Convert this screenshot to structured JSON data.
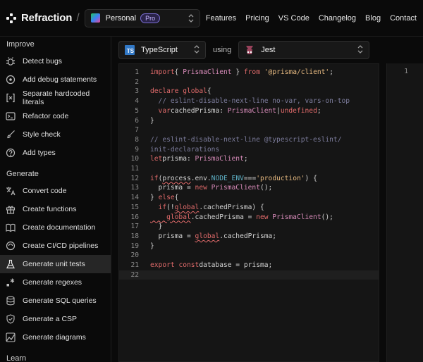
{
  "brand": {
    "name": "Refraction"
  },
  "team": {
    "name": "Personal",
    "badge": "Pro"
  },
  "nav": {
    "items": [
      "Features",
      "Pricing",
      "VS Code",
      "Changelog",
      "Blog",
      "Contact"
    ]
  },
  "sidebar": {
    "sections": [
      {
        "title": "Improve",
        "items": [
          {
            "label": "Detect bugs",
            "icon": "bug-icon"
          },
          {
            "label": "Add debug statements",
            "icon": "debug-icon"
          },
          {
            "label": "Separate hardcoded literals",
            "icon": "brackets-x-icon"
          },
          {
            "label": "Refactor code",
            "icon": "terminal-icon"
          },
          {
            "label": "Style check",
            "icon": "brush-icon"
          },
          {
            "label": "Add types",
            "icon": "question-circle-icon"
          }
        ]
      },
      {
        "title": "Generate",
        "items": [
          {
            "label": "Convert code",
            "icon": "translate-icon"
          },
          {
            "label": "Create functions",
            "icon": "gift-icon"
          },
          {
            "label": "Create documentation",
            "icon": "book-icon"
          },
          {
            "label": "Create CI/CD pipelines",
            "icon": "pipeline-icon"
          },
          {
            "label": "Generate unit tests",
            "icon": "flask-icon",
            "active": true
          },
          {
            "label": "Generate regexes",
            "icon": "regex-icon"
          },
          {
            "label": "Generate SQL queries",
            "icon": "database-icon"
          },
          {
            "label": "Generate a CSP",
            "icon": "shield-icon"
          },
          {
            "label": "Generate diagrams",
            "icon": "diagram-icon"
          }
        ]
      },
      {
        "title": "Learn",
        "items": []
      }
    ]
  },
  "toolbar": {
    "language": "TypeScript",
    "using_label": "using",
    "framework": "Jest"
  },
  "editor": {
    "lines": [
      [
        [
          "kw",
          "import"
        ],
        [
          "",
          "{ "
        ],
        [
          "ty",
          "PrismaClient"
        ],
        [
          "",
          ""
        ],
        [
          "",
          "} "
        ],
        [
          "kw",
          "from"
        ],
        [
          "",
          ""
        ],
        [
          "str",
          "'@prisma/client'"
        ],
        [
          "",
          ";"
        ]
      ],
      [],
      [
        [
          "kw",
          "declare"
        ],
        [
          "",
          ""
        ],
        [
          "kw",
          "global"
        ],
        [
          "",
          "{"
        ]
      ],
      [
        [
          "cm",
          "  // eslint-disable-next-line no-var, vars-on-top"
        ]
      ],
      [
        [
          "kw",
          "  var"
        ],
        [
          "",
          "cachedPrisma: "
        ],
        [
          "ty",
          "PrismaClient"
        ],
        [
          "",
          "|"
        ],
        [
          "kw",
          "undefined"
        ],
        [
          "",
          ";"
        ]
      ],
      [
        [
          "",
          "}"
        ]
      ],
      [],
      [
        [
          "cm",
          "// eslint-disable-next-line @typescript-eslint/"
        ]
      ],
      [
        [
          "cm",
          "init-declarations"
        ]
      ],
      [
        [
          "kw",
          "let"
        ],
        [
          "",
          "prisma: "
        ],
        [
          "ty",
          "PrismaClient"
        ],
        [
          "",
          ";"
        ]
      ],
      [],
      [
        [
          "kw",
          "if"
        ],
        [
          "",
          "("
        ],
        [
          "sq",
          "process"
        ],
        [
          "",
          ".env."
        ],
        [
          "cn",
          "NODE_ENV"
        ],
        [
          "",
          "==="
        ],
        [
          "str",
          "'production'"
        ],
        [
          "",
          ") {"
        ]
      ],
      [
        [
          "",
          "  prisma = "
        ],
        [
          "kw",
          "new"
        ],
        [
          "",
          ""
        ],
        [
          "ty",
          "PrismaClient"
        ],
        [
          "",
          "();"
        ]
      ],
      [
        [
          "",
          "} "
        ],
        [
          "kw",
          "else"
        ],
        [
          "",
          "{"
        ]
      ],
      [
        [
          "kw",
          "  if"
        ],
        [
          "",
          "(!"
        ],
        [
          "sqk",
          "global"
        ],
        [
          "",
          ".cachedPrisma) {"
        ]
      ],
      [
        [
          "sqk",
          "    global"
        ],
        [
          "",
          ".cachedPrisma = "
        ],
        [
          "kw",
          "new"
        ],
        [
          "",
          ""
        ],
        [
          "ty",
          "PrismaClient"
        ],
        [
          "",
          "();"
        ]
      ],
      [
        [
          "",
          "  }"
        ]
      ],
      [
        [
          "",
          "  prisma = "
        ],
        [
          "sqk",
          "global"
        ],
        [
          "",
          ".cachedPrisma;"
        ]
      ],
      [
        [
          "",
          "}"
        ]
      ],
      [],
      [
        [
          "kw",
          "export"
        ],
        [
          "",
          ""
        ],
        [
          "kw",
          "const"
        ],
        [
          "",
          "database = prisma;"
        ]
      ],
      []
    ]
  },
  "right_editor": {
    "line_numbers": [
      "1",
      "",
      "",
      "",
      "",
      "",
      "",
      "",
      "",
      "",
      "",
      "",
      "",
      "",
      "",
      "",
      ""
    ]
  }
}
